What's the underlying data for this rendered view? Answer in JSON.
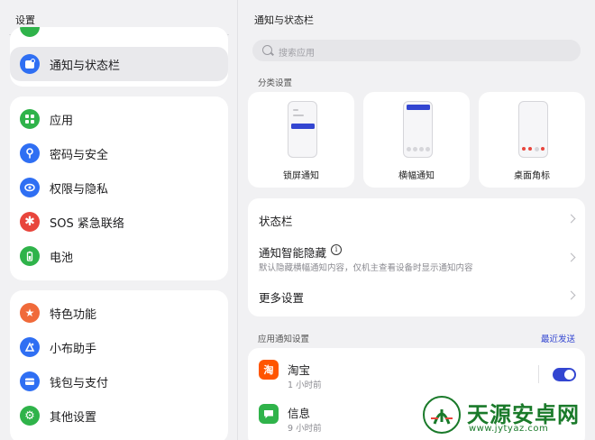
{
  "left": {
    "title": "设置",
    "selected_item": {
      "label": "通知与状态栏",
      "icon": "notification-icon",
      "color": "#2f6ff3"
    },
    "group1": [
      {
        "label": "应用",
        "icon": "apps-icon",
        "color": "#2fb34a"
      },
      {
        "label": "密码与安全",
        "icon": "key-icon",
        "color": "#2f6ff3"
      },
      {
        "label": "权限与隐私",
        "icon": "privacy-icon",
        "color": "#2f6ff3"
      },
      {
        "label": "SOS 紧急联络",
        "icon": "sos-icon",
        "color": "#e8453c"
      },
      {
        "label": "电池",
        "icon": "battery-icon",
        "color": "#2fb34a"
      }
    ],
    "group2": [
      {
        "label": "特色功能",
        "icon": "star-icon",
        "color": "#f06a3a"
      },
      {
        "label": "小布助手",
        "icon": "assistant-icon",
        "color": "#2f6ff3"
      },
      {
        "label": "钱包与支付",
        "icon": "wallet-icon",
        "color": "#2f6ff3"
      },
      {
        "label": "其他设置",
        "icon": "gear-icon",
        "color": "#2fb34a"
      }
    ]
  },
  "right": {
    "title": "通知与状态栏",
    "search_placeholder": "搜索应用",
    "category_label": "分类设置",
    "styles": [
      {
        "caption": "锁屏通知"
      },
      {
        "caption": "横幅通知"
      },
      {
        "caption": "桌面角标"
      }
    ],
    "rows": [
      {
        "title": "状态栏"
      },
      {
        "title": "通知智能隐藏",
        "subtitle": "默认隐藏横幅通知内容，仅机主查看设备时显示通知内容"
      },
      {
        "title": "更多设置"
      }
    ],
    "app_section_label": "应用通知设置",
    "recent_label": "最近发送",
    "apps": [
      {
        "name": "淘宝",
        "time": "1 小时前",
        "icon": "taobao-icon",
        "badge": "淘",
        "color": "#ff5500",
        "enabled": true
      },
      {
        "name": "信息",
        "time": "9 小时前",
        "icon": "messages-icon",
        "badge": "",
        "color": "#2fb34a"
      }
    ],
    "accent": "#3346d1"
  },
  "watermark": {
    "text": "天源安卓网",
    "url": "www.jytyaz.com"
  }
}
